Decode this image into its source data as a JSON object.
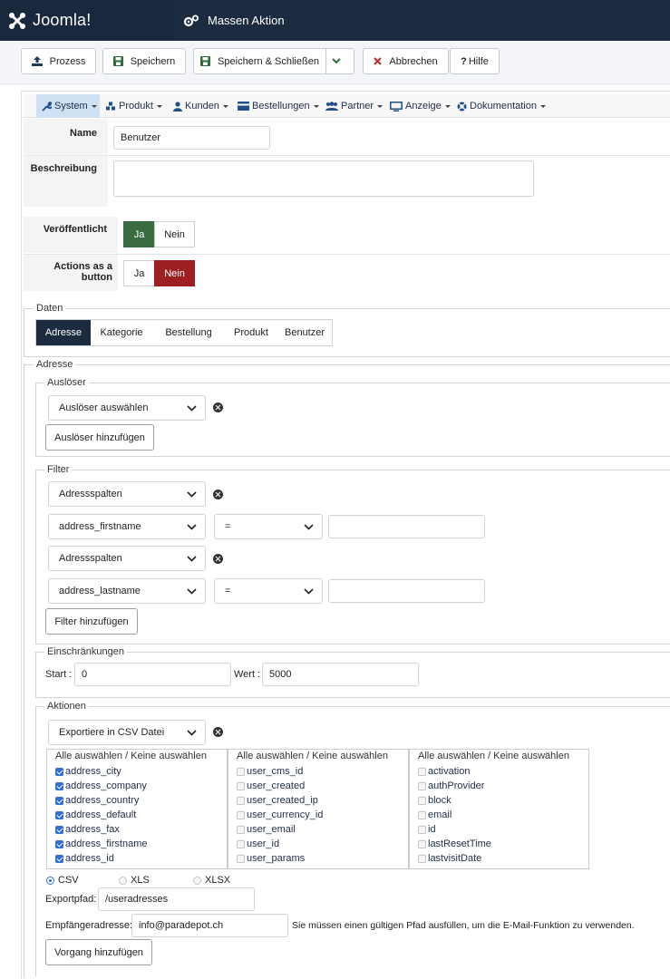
{
  "header": {
    "brand": "Joomla!",
    "page_title": "Massen Aktion"
  },
  "toolbar": {
    "process": "Prozess",
    "save": "Speichern",
    "save_close": "Speichern & Schließen",
    "cancel": "Abbrechen",
    "help": "Hilfe"
  },
  "menu": [
    {
      "label": "System",
      "icon": "wrench-icon"
    },
    {
      "label": "Produkt",
      "icon": "cubes-icon"
    },
    {
      "label": "Kunden",
      "icon": "user-icon"
    },
    {
      "label": "Bestellungen",
      "icon": "credit-card-icon"
    },
    {
      "label": "Partner",
      "icon": "users-icon"
    },
    {
      "label": "Anzeige",
      "icon": "monitor-icon"
    },
    {
      "label": "Dokumentation",
      "icon": "lifebuoy-icon"
    }
  ],
  "form": {
    "name_label": "Name",
    "name_value": "Benutzer",
    "description_label": "Beschreibung",
    "description_value": "",
    "published_label": "Veröffentlicht",
    "button_label": "Actions as a button",
    "yes": "Ja",
    "no": "Nein",
    "published_value": "Ja",
    "button_value": "Nein"
  },
  "colors": {
    "header_bg": "#1c2b40",
    "yes_active": "#3a6b41",
    "no_active": "#9e1f22",
    "tab_active": "#1d2b40",
    "link_blue": "#1f2d44"
  },
  "daten": {
    "legend": "Daten",
    "tabs": [
      "Adresse",
      "Kategorie",
      "Bestellung",
      "Produkt",
      "Benutzer"
    ],
    "active_tab": "Adresse"
  },
  "adresse": {
    "legend": "Adresse",
    "trigger": {
      "legend": "Auslöser",
      "select_value": "Auslöser auswählen",
      "add_button": "Auslöser hinzufügen"
    },
    "filter": {
      "legend": "Filter",
      "rows": [
        {
          "column_select": "Adressspalten",
          "field_select": "address_firstname",
          "operator": "=",
          "value": ""
        },
        {
          "column_select": "Adressspalten",
          "field_select": "address_lastname",
          "operator": "=",
          "value": ""
        }
      ],
      "add_button": "Filter hinzufügen"
    },
    "limits": {
      "legend": "Einschränkungen",
      "start_label": "Start :",
      "start_value": "0",
      "value_label": "Wert :",
      "value_value": "5000"
    },
    "actions": {
      "legend": "Aktionen",
      "select_value": "Exportiere in CSV Datei",
      "select_all_label": "Alle auswählen / Keine auswählen",
      "column_lists": [
        {
          "items": [
            {
              "label": "address_city",
              "checked": true
            },
            {
              "label": "address_company",
              "checked": true
            },
            {
              "label": "address_country",
              "checked": true
            },
            {
              "label": "address_default",
              "checked": true
            },
            {
              "label": "address_fax",
              "checked": true
            },
            {
              "label": "address_firstname",
              "checked": true
            },
            {
              "label": "address_id",
              "checked": true
            }
          ]
        },
        {
          "items": [
            {
              "label": "user_cms_id",
              "checked": false
            },
            {
              "label": "user_created",
              "checked": false
            },
            {
              "label": "user_created_ip",
              "checked": false
            },
            {
              "label": "user_currency_id",
              "checked": false
            },
            {
              "label": "user_email",
              "checked": false
            },
            {
              "label": "user_id",
              "checked": false
            },
            {
              "label": "user_params",
              "checked": false
            }
          ]
        },
        {
          "items": [
            {
              "label": "activation",
              "checked": false
            },
            {
              "label": "authProvider",
              "checked": false
            },
            {
              "label": "block",
              "checked": false
            },
            {
              "label": "email",
              "checked": false
            },
            {
              "label": "id",
              "checked": false
            },
            {
              "label": "lastResetTime",
              "checked": false
            },
            {
              "label": "lastvisitDate",
              "checked": false
            }
          ]
        }
      ],
      "formats": [
        "CSV",
        "XLS",
        "XLSX"
      ],
      "selected_format": "CSV",
      "export_path_label": "Exportpfad:",
      "export_path_value": "/useradresses",
      "recipient_label": "Empfängeradresse:",
      "recipient_value": "info@paradepot.ch",
      "recipient_hint": "Sie müssen einen gültigen Pfad ausfüllen, um die E-Mail-Funktion zu verwenden.",
      "add_button": "Vorgang hinzufügen"
    }
  }
}
